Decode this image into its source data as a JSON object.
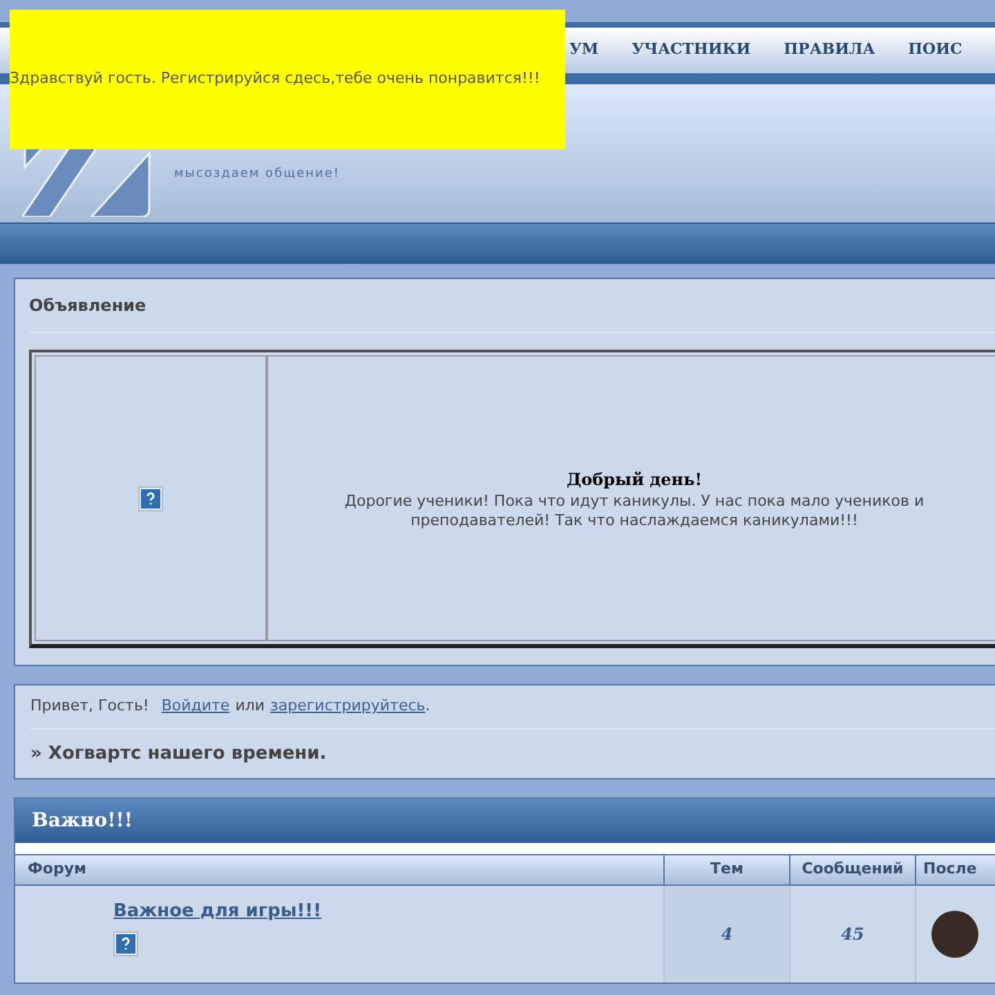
{
  "notice": {
    "text": "Здравствуй гость. Регистрируйся сдесь,тебе очень понравится!!!"
  },
  "nav": {
    "items": [
      "УМ",
      "УЧАСТНИКИ",
      "ПРАВИЛА",
      "ПОИС"
    ]
  },
  "header": {
    "tagline": "мысоздаем общение!"
  },
  "announcement": {
    "title": "Объявление",
    "heading": "Добрый день!",
    "body": "Дорогие ученики! Пока что идут каникулы. У нас пока мало учеников и преподавателей! Так что наслаждаемся каникулами!!!"
  },
  "welcome": {
    "greeting": "Привет, Гость!",
    "login_link": "Войдите",
    "separator": "или",
    "register_link": "зарегистрируйтесь",
    "end": ".",
    "forum_name": "» Хогвартс нашего времени."
  },
  "category": {
    "title": "Важно!!!",
    "columns": [
      "Форум",
      "Тем",
      "Сообщений",
      "После"
    ],
    "rows": [
      {
        "name": "Важное для игры!!!",
        "topics": "4",
        "posts": "45"
      }
    ]
  }
}
